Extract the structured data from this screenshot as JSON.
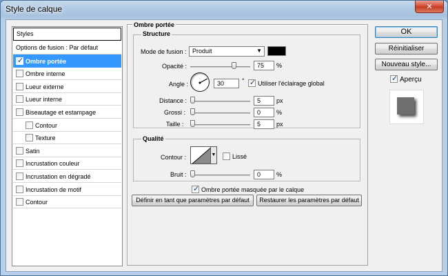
{
  "window": {
    "title": "Style de calque",
    "close_symbol": "✕"
  },
  "left_panel": {
    "header": "Styles",
    "items": [
      {
        "label": "Options de fusion : Par défaut",
        "checkbox": false,
        "checked": false,
        "indent": false,
        "selected": false
      },
      {
        "label": "Ombre portée",
        "checkbox": true,
        "checked": true,
        "indent": false,
        "selected": true
      },
      {
        "label": "Ombre interne",
        "checkbox": true,
        "checked": false,
        "indent": false,
        "selected": false
      },
      {
        "label": "Lueur externe",
        "checkbox": true,
        "checked": false,
        "indent": false,
        "selected": false
      },
      {
        "label": "Lueur interne",
        "checkbox": true,
        "checked": false,
        "indent": false,
        "selected": false
      },
      {
        "label": "Biseautage et estampage",
        "checkbox": true,
        "checked": false,
        "indent": false,
        "selected": false
      },
      {
        "label": "Contour",
        "checkbox": true,
        "checked": false,
        "indent": true,
        "selected": false
      },
      {
        "label": "Texture",
        "checkbox": true,
        "checked": false,
        "indent": true,
        "selected": false
      },
      {
        "label": "Satin",
        "checkbox": true,
        "checked": false,
        "indent": false,
        "selected": false
      },
      {
        "label": "Incrustation couleur",
        "checkbox": true,
        "checked": false,
        "indent": false,
        "selected": false
      },
      {
        "label": "Incrustation en dégradé",
        "checkbox": true,
        "checked": false,
        "indent": false,
        "selected": false
      },
      {
        "label": "Incrustation de motif",
        "checkbox": true,
        "checked": false,
        "indent": false,
        "selected": false
      },
      {
        "label": "Contour",
        "checkbox": true,
        "checked": false,
        "indent": false,
        "selected": false
      }
    ]
  },
  "main": {
    "section_title": "Ombre portée",
    "structure": {
      "title": "Structure",
      "blend_mode_label": "Mode de fusion :",
      "blend_mode_value": "Produit",
      "blend_color": "#000000",
      "opacity_label": "Opacité :",
      "opacity_value": "75",
      "opacity_unit": "%",
      "opacity_fraction": 0.75,
      "angle_label": "Angle :",
      "angle_value": "30",
      "angle_unit": "°",
      "global_light_label": "Utiliser l'éclairage global",
      "global_light_checked": true,
      "distance_label": "Distance :",
      "distance_value": "5",
      "distance_unit": "px",
      "spread_label": "Grossi :",
      "spread_value": "0",
      "spread_unit": "%",
      "size_label": "Taille :",
      "size_value": "5",
      "size_unit": "px"
    },
    "quality": {
      "title": "Qualité",
      "contour_label": "Contour :",
      "antialias_label": "Lissé",
      "antialias_checked": false,
      "noise_label": "Bruit :",
      "noise_value": "0",
      "noise_unit": "%"
    },
    "knockout_label": "Ombre portée masquée par le calque",
    "knockout_checked": true,
    "make_default_label": "Définir en tant que paramètres par défaut",
    "reset_default_label": "Restaurer les paramètres par défaut"
  },
  "right_panel": {
    "ok_label": "OK",
    "reset_label": "Réinitialiser",
    "new_style_label": "Nouveau style...",
    "preview_label": "Aperçu",
    "preview_checked": true
  }
}
